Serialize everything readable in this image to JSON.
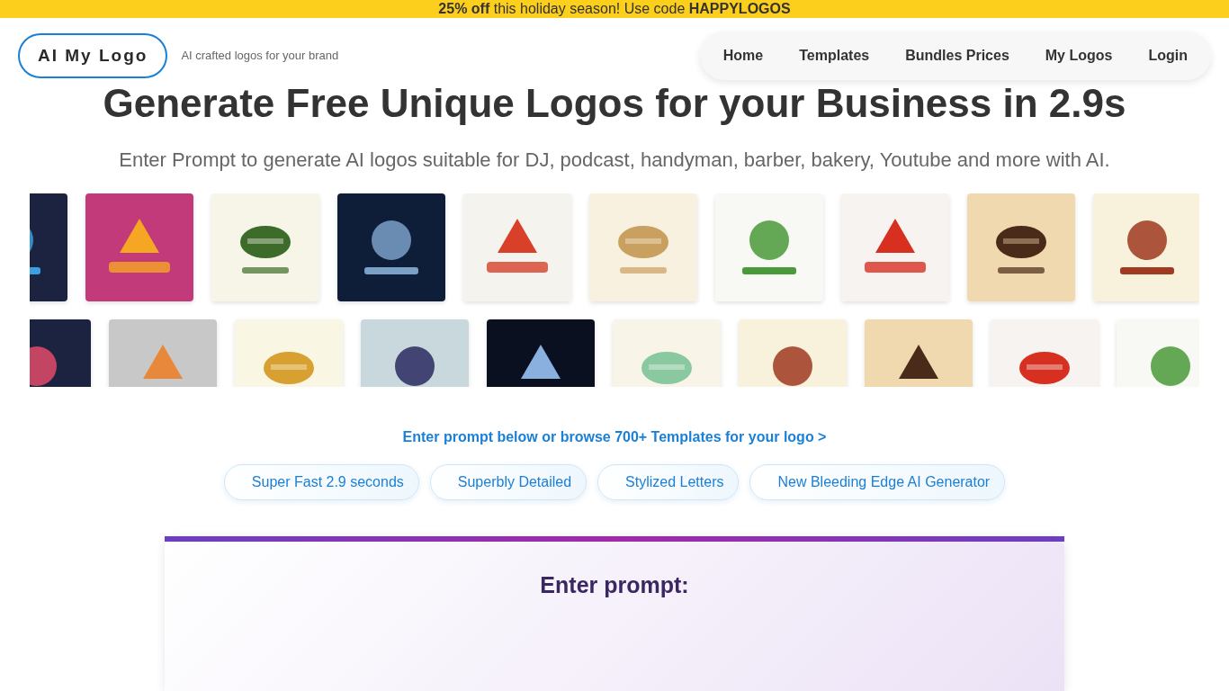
{
  "promo_banner": {
    "text": "**25% off** this holiday season! Use code **HAPPYLOGOS**"
  },
  "header": {
    "logo": "AI My Logo",
    "tagline": "AI crafted logos for your brand",
    "nav": [
      {
        "label": "Home"
      },
      {
        "label": "Templates"
      },
      {
        "label": "Bundles Prices"
      },
      {
        "label": "My Logos"
      },
      {
        "label": "Login"
      }
    ]
  },
  "hero": {
    "title": "Generate Free Unique Logos for your Business in 2.9s",
    "subtitle": "Enter Prompt to generate AI logos suitable for DJ, podcast, handyman, barber, bakery, Youtube and more with AI."
  },
  "logo_rows": [
    [
      {
        "kind": "picture"
      },
      {
        "kind": "picture"
      },
      {
        "kind": "picture"
      },
      {
        "kind": "picture"
      },
      {
        "kind": "picture"
      },
      {
        "kind": "picture"
      },
      {
        "kind": "picture"
      },
      {
        "kind": "picture"
      },
      {
        "kind": "picture"
      },
      {
        "kind": "picture"
      }
    ],
    [
      {
        "kind": "picture"
      },
      {
        "kind": "picture"
      },
      {
        "kind": "picture"
      },
      {
        "kind": "picture"
      },
      {
        "kind": "picture"
      },
      {
        "kind": "picture"
      },
      {
        "kind": "picture"
      },
      {
        "kind": "picture"
      },
      {
        "kind": "picture"
      },
      {
        "kind": "picture"
      }
    ]
  ],
  "templates_link": "Enter prompt below or browse 700+ Templates for your logo >",
  "features": [
    "Super Fast 2.9 seconds",
    "Superbly Detailed",
    "Stylized Letters",
    "New Bleeding Edge AI Generator"
  ],
  "prompt_card": {
    "heading": "Enter prompt:"
  }
}
